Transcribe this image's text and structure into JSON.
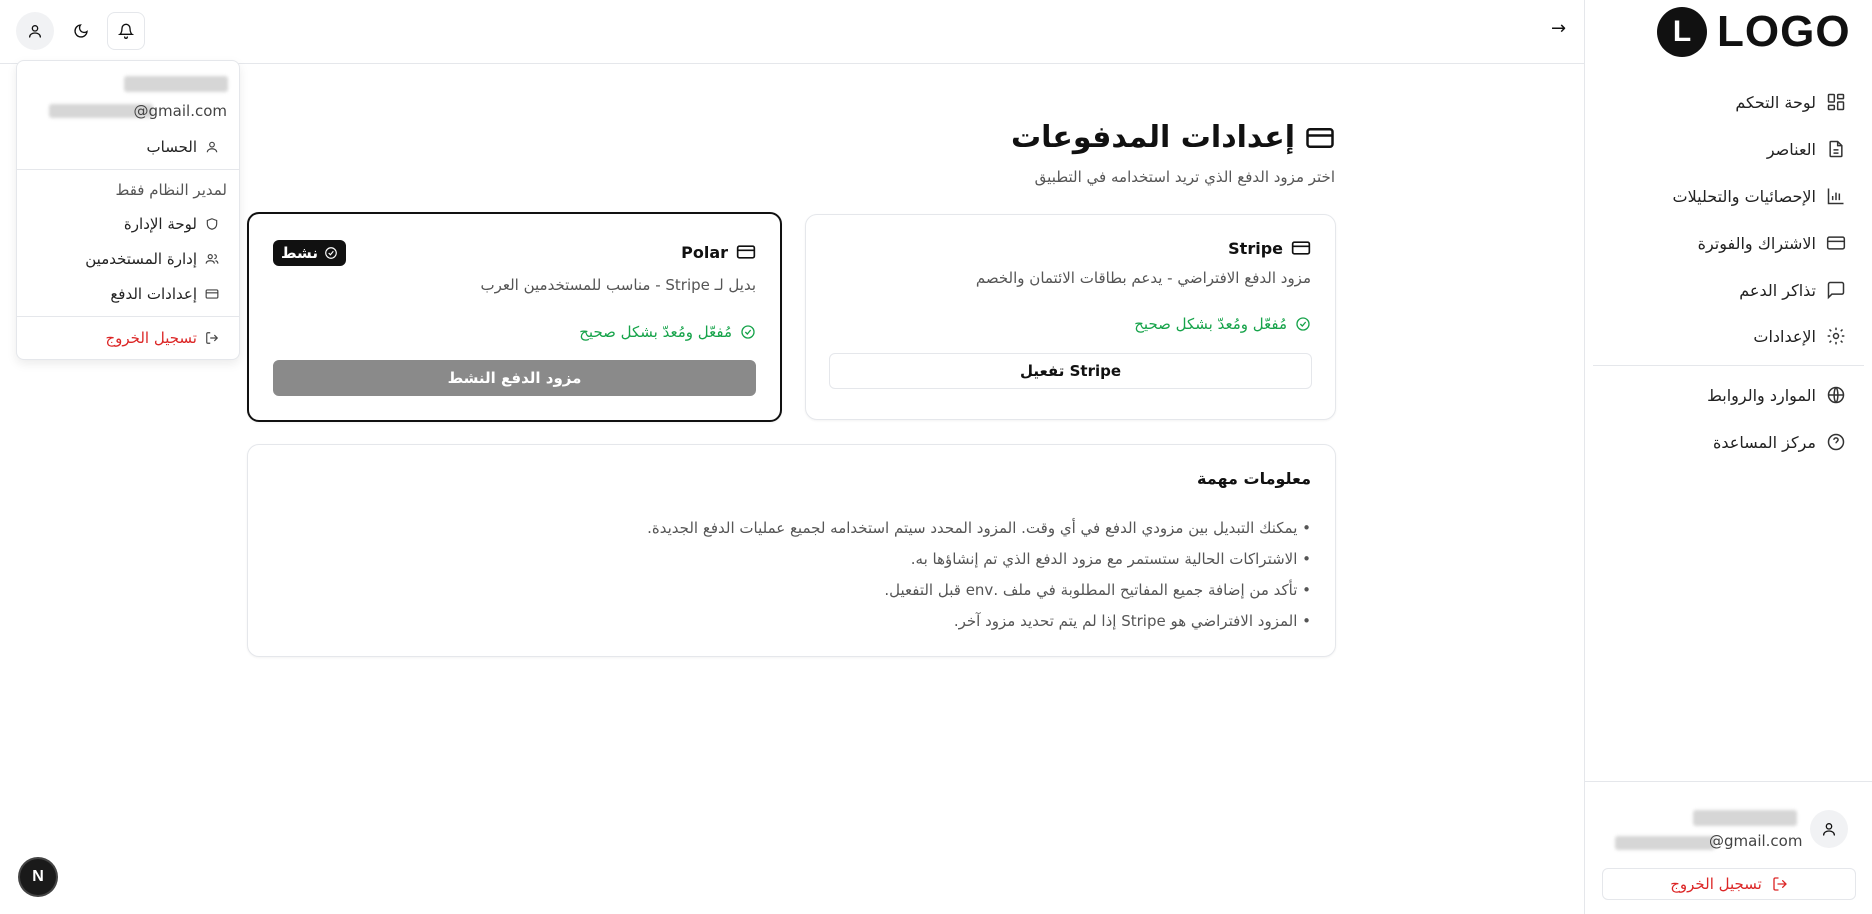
{
  "brand": {
    "logo_letter": "L",
    "logo_text": "LOGO"
  },
  "header": {
    "collapse_arrow": "→"
  },
  "sidebar": {
    "items": [
      {
        "label": "لوحة التحكم",
        "icon": "dashboard-grid-icon"
      },
      {
        "label": "العناصر",
        "icon": "document-icon"
      },
      {
        "label": "الإحصائيات والتحليلات",
        "icon": "bar-chart-icon"
      },
      {
        "label": "الاشتراك والفوترة",
        "icon": "credit-card-icon"
      },
      {
        "label": "تذاكر الدعم",
        "icon": "message-icon"
      },
      {
        "label": "الإعدادات",
        "icon": "gear-icon"
      }
    ],
    "secondary_items": [
      {
        "label": "الموارد والروابط",
        "icon": "globe-icon"
      },
      {
        "label": "مركز المساعدة",
        "icon": "help-circle-icon"
      }
    ],
    "user": {
      "email": "@gmail.com"
    },
    "logout_label": "تسجيل الخروج"
  },
  "main": {
    "title": "إعدادات المدفوعات",
    "subtitle": "اختر مزود الدفع الذي تريد استخدامه في التطبيق",
    "providers": {
      "stripe": {
        "name": "Stripe",
        "description": "مزود الدفع الافتراضي - يدعم بطاقات الائتمان والخصم",
        "status": "مُفعّل ومُعدّ بشكل صحيح",
        "button": "تفعيل Stripe"
      },
      "polar": {
        "name": "Polar",
        "description": "بديل لـ Stripe - مناسب للمستخدمين العرب",
        "status": "مُفعّل ومُعدّ بشكل صحيح",
        "badge": "نشط",
        "button": "مزود الدفع النشط"
      }
    },
    "info": {
      "title": "معلومات مهمة",
      "items": [
        "• يمكنك التبديل بين مزودي الدفع في أي وقت. المزود المحدد سيتم استخدامه لجميع عمليات الدفع الجديدة.",
        "• الاشتراكات الحالية ستستمر مع مزود الدفع الذي تم إنشاؤها به.",
        "• تأكد من إضافة جميع المفاتيح المطلوبة في ملف .env قبل التفعيل.",
        "• المزود الافتراضي هو Stripe إذا لم يتم تحديد مزود آخر."
      ]
    }
  },
  "dropdown": {
    "email": "@gmail.com",
    "account": "الحساب",
    "admin_label": "لمدير النظام فقط",
    "admin_panel": "لوحة الإدارة",
    "users": "إدارة المستخدمين",
    "payments": "إعدادات الدفع",
    "logout": "تسجيل الخروج"
  },
  "dev_badge": "N",
  "colors": {
    "success": "#16a34a",
    "danger": "#dc2626",
    "disabled_button": "#8a8a8a"
  }
}
